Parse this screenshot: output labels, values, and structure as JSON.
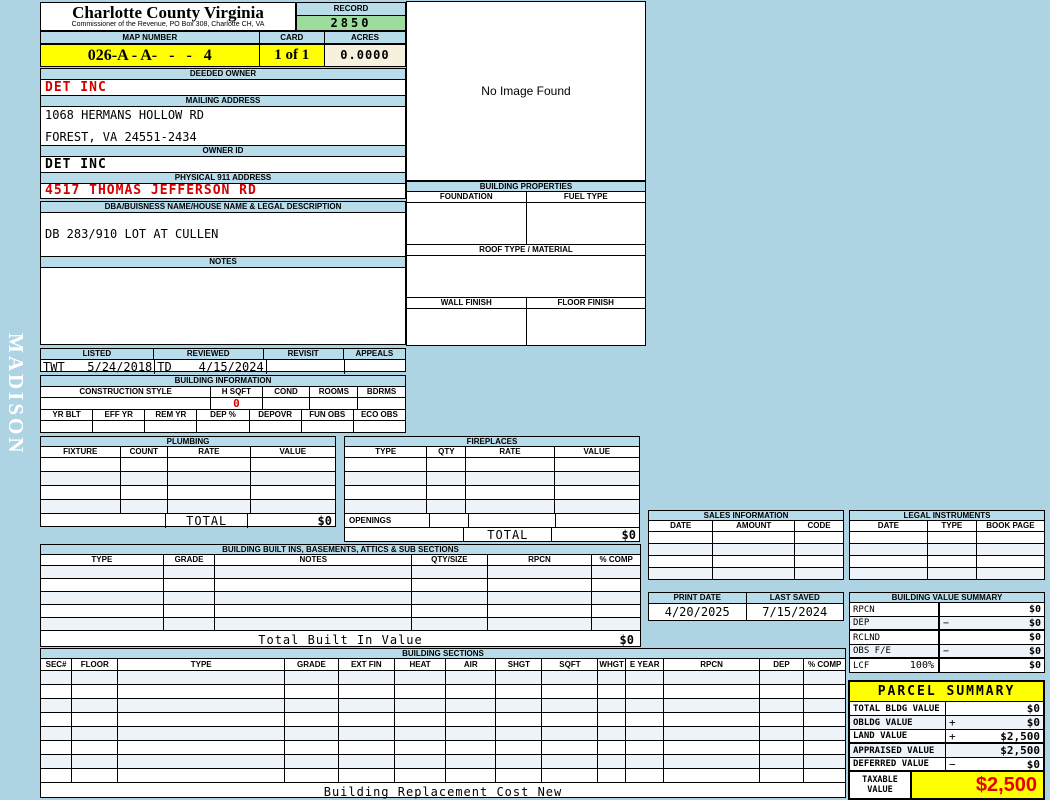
{
  "watermark": {
    "text": "MADISON"
  },
  "header": {
    "county": "Charlotte County Virginia",
    "commissioner": "Commissioner of the Revenue, PO Box 308, Charlotte CH, VA",
    "record_label": "RECORD",
    "record_value": "2850",
    "map_label": "MAP NUMBER",
    "map_value": "026-A - A-   -   -   4",
    "card_label": "CARD",
    "card_value": "1 of 1",
    "acres_label": "ACRES",
    "acres_value": "0.0000"
  },
  "owner": {
    "deeded_label": "DEEDED OWNER",
    "deeded_value": "DET INC",
    "mailing_label": "MAILING ADDRESS",
    "mailing_line1": "1068 HERMANS HOLLOW RD",
    "mailing_line2": "FOREST, VA 24551-2434",
    "owner_id_label": "OWNER ID",
    "owner_id_value": "DET INC",
    "physical_label": "PHYSICAL 911 ADDRESS",
    "physical_value": "4517 THOMAS JEFFERSON RD",
    "dba_label": "DBA/BUISNESS NAME/HOUSE NAME & LEGAL DESCRIPTION",
    "legal_value": "DB 283/910 LOT AT CULLEN",
    "notes_label": "NOTES"
  },
  "review": {
    "headers": [
      "LISTED",
      "REVIEWED",
      "REVISIT",
      "APPEALS"
    ],
    "listed_by": "TWT",
    "listed_date": "5/24/2018",
    "reviewed_by": "TD",
    "reviewed_date": "4/15/2024"
  },
  "building_info": {
    "title": "BUILDING INFORMATION",
    "row1_headers": [
      "CONSTRUCTION STYLE",
      "H SQFT",
      "COND",
      "ROOMS",
      "BDRMS"
    ],
    "h_sqft": "0",
    "row2_headers": [
      "YR BLT",
      "EFF YR",
      "REM YR",
      "DEP %",
      "DEPOVR",
      "FUN OBS",
      "ECO OBS"
    ]
  },
  "plumbing": {
    "title": "PLUMBING",
    "headers": [
      "FIXTURE",
      "COUNT",
      "RATE",
      "VALUE"
    ],
    "total_label": "TOTAL",
    "total_value": "$0"
  },
  "fireplaces": {
    "title": "FIREPLACES",
    "headers": [
      "TYPE",
      "QTY",
      "RATE",
      "VALUE"
    ],
    "openings_label": "OPENINGS",
    "total_label": "TOTAL",
    "total_value": "$0"
  },
  "built_ins": {
    "title": "BUILDING BUILT INS, BASEMENTS, ATTICS & SUB SECTIONS",
    "headers": [
      "TYPE",
      "GRADE",
      "NOTES",
      "QTY/SIZE",
      "RPCN",
      "% COMP"
    ],
    "total_label": "Total Built In Value",
    "total_value": "$0"
  },
  "building_sections": {
    "title": "BUILDING SECTIONS",
    "headers": [
      "SEC#",
      "FLOOR",
      "TYPE",
      "GRADE",
      "EXT FIN",
      "HEAT",
      "AIR",
      "SHGT",
      "SQFT",
      "WHGT",
      "E YEAR",
      "RPCN",
      "DEP",
      "% COMP"
    ],
    "footer_label": "Building Replacement Cost New"
  },
  "image_box": {
    "text": "No Image Found"
  },
  "building_properties": {
    "title": "BUILDING PROPERTIES",
    "foundation_label": "FOUNDATION",
    "fuel_label": "FUEL TYPE",
    "roof_label": "ROOF TYPE / MATERIAL",
    "wall_label": "WALL FINISH",
    "floor_label": "FLOOR FINISH"
  },
  "sales": {
    "title": "SALES INFORMATION",
    "headers": [
      "DATE",
      "AMOUNT",
      "CODE"
    ]
  },
  "legal": {
    "title": "LEGAL INSTRUMENTS",
    "headers": [
      "DATE",
      "TYPE",
      "BOOK PAGE"
    ]
  },
  "dates": {
    "print_label": "PRINT DATE",
    "print_value": "4/20/2025",
    "saved_label": "LAST SAVED",
    "saved_value": "7/15/2024"
  },
  "value_summary": {
    "title": "BUILDING VALUE SUMMARY",
    "rows": [
      {
        "label": "RPCN",
        "op": "",
        "value": "$0"
      },
      {
        "label": "DEP",
        "op": "−",
        "value": "$0"
      },
      {
        "label": "RCLND",
        "op": "",
        "value": "$0"
      },
      {
        "label": "OBS F/E",
        "op": "−",
        "value": "$0"
      },
      {
        "label": "LCF",
        "pct": "100%",
        "op": "",
        "value": "$0"
      }
    ]
  },
  "parcel_summary": {
    "title": "PARCEL SUMMARY",
    "rows": [
      {
        "label": "TOTAL BLDG VALUE",
        "op": "",
        "value": "$0"
      },
      {
        "label": "OBLDG VALUE",
        "op": "+",
        "value": "$0"
      },
      {
        "label": "LAND VALUE",
        "op": "+",
        "value": "$2,500"
      },
      {
        "label": "APPRAISED VALUE",
        "op": "",
        "value": "$2,500"
      },
      {
        "label": "DEFERRED VALUE",
        "op": "−",
        "value": "$0"
      }
    ],
    "taxable_line1": "TAXABLE",
    "taxable_line2": "VALUE",
    "taxable_value": "$2,500"
  },
  "colors": {
    "page_bg": "#aed4e4",
    "bar_bg": "#b9dcea",
    "record_green": "#9cdc9c",
    "map_yellow": "#ffff00",
    "acres_cream": "#f5f1dd",
    "value_red": "#d40000",
    "alt_row": "#eef2f9"
  }
}
